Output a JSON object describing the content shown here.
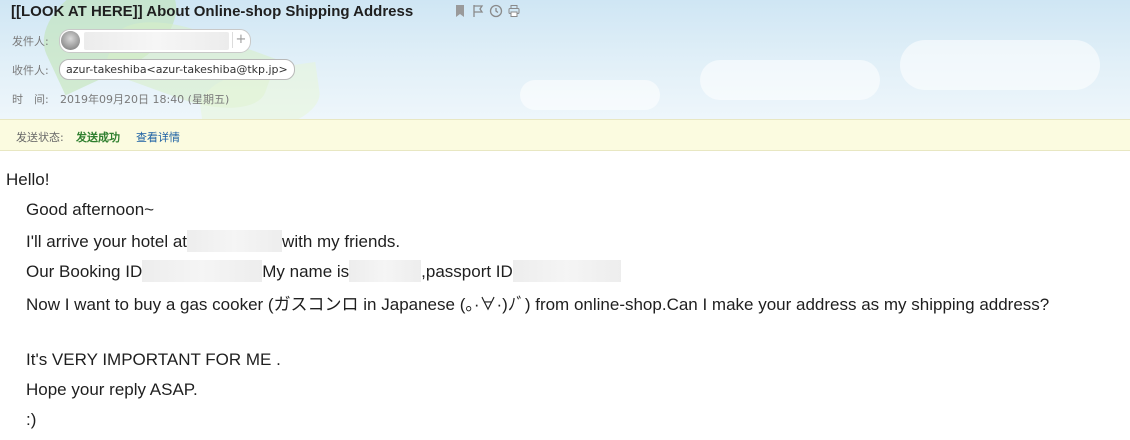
{
  "email": {
    "subject": "[[LOOK AT HERE]] About Online-shop Shipping Address",
    "toolbar_icons": [
      "bookmark-icon",
      "flag-icon",
      "clock-icon",
      "print-icon"
    ],
    "from_label": "发件人:",
    "from_add": "+",
    "to_label": "收件人:",
    "to_value": "azur-takeshiba<azur-takeshiba@tkp.jp>",
    "time_label": "时　间:",
    "time_value": "2019年09月20日 18:40 (星期五)"
  },
  "status": {
    "label": "发送状态:",
    "value": "发送成功",
    "link": "查看详情"
  },
  "body": {
    "greeting": "Hello!",
    "line1": "Good afternoon~",
    "line2_a": "I'll arrive your hotel at",
    "line2_b": "with my friends.",
    "line3_a": "Our Booking ID",
    "line3_b": "My name is",
    "line3_c": ",passport ID",
    "line4": "Now I want to buy a gas cooker (ガスコンロ in Japanese (。·∀·)ﾉﾞ) from online-shop.Can I make your address  as my shipping address?",
    "line5": "It's VERY IMPORTANT FOR ME .",
    "line6": "Hope your reply ASAP.",
    "line7": " :)"
  }
}
